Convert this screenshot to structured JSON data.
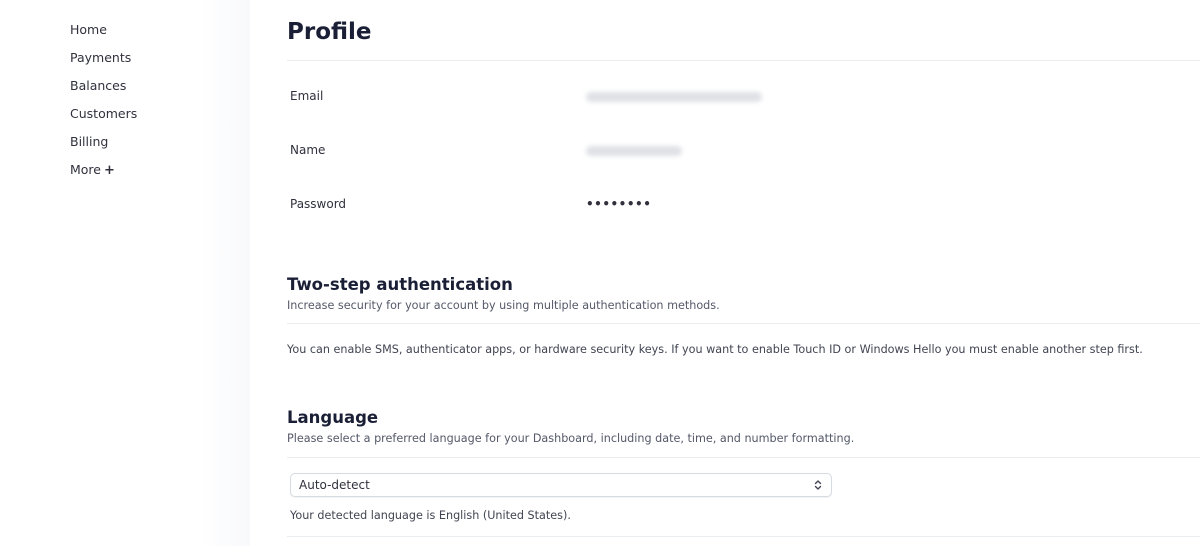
{
  "sidebar": {
    "items": [
      {
        "label": "Home"
      },
      {
        "label": "Payments"
      },
      {
        "label": "Balances"
      },
      {
        "label": "Customers"
      },
      {
        "label": "Billing"
      },
      {
        "label": "More",
        "suffix": "+"
      }
    ]
  },
  "profile": {
    "title": "Profile",
    "fields": [
      {
        "label": "Email",
        "value_hidden": true
      },
      {
        "label": "Name",
        "value_hidden": true
      },
      {
        "label": "Password",
        "value": "••••••••"
      }
    ]
  },
  "two_step": {
    "title": "Two-step authentication",
    "subtitle": "Increase security for your account by using multiple authentication methods.",
    "body": "You can enable SMS, authenticator apps, or hardware security keys. If you want to enable Touch ID or Windows Hello you must enable another step first."
  },
  "language": {
    "title": "Language",
    "subtitle": "Please select a preferred language for your Dashboard, including date, time, and number formatting.",
    "select_value": "Auto-detect",
    "hint": "Your detected language is English (United States)."
  },
  "icons": {
    "select_chevrons": "chevron-up-down-icon",
    "more_plus": "plus-icon"
  },
  "colors": {
    "text_primary": "#1a1f36",
    "text_secondary": "#545969",
    "divider": "#ebeef1"
  }
}
